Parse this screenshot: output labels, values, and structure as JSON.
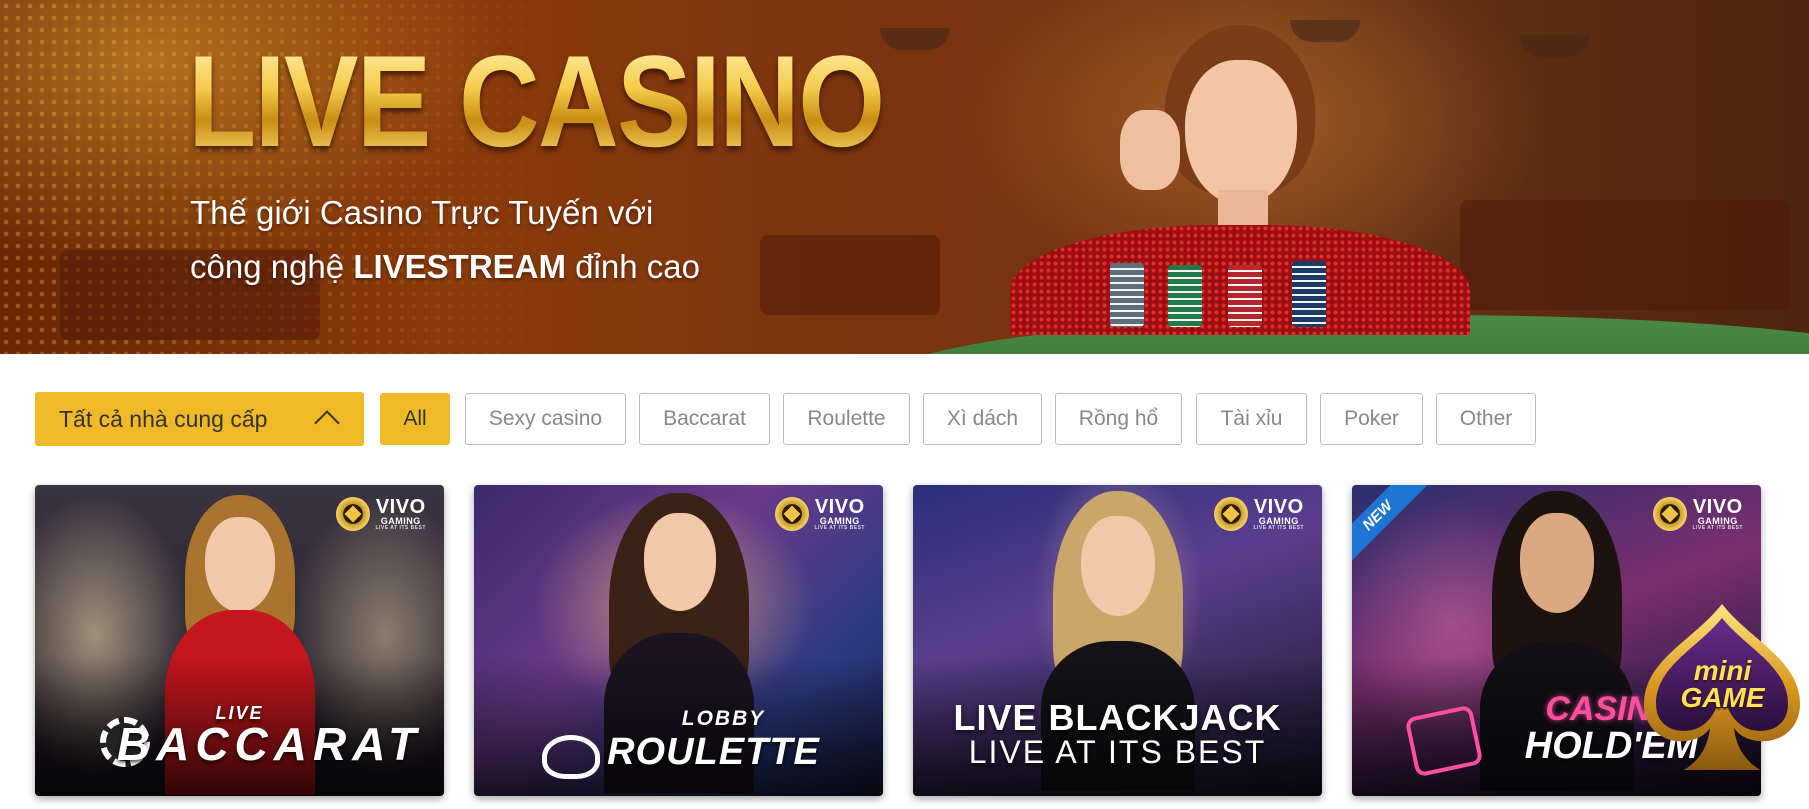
{
  "hero": {
    "title": "LIVE CASINO",
    "subtitle_line1": "Thế giới Casino Trực Tuyến với",
    "subtitle_line2_prefix": "công nghệ",
    "subtitle_line2_bold": "LIVESTREAM",
    "subtitle_line2_suffix": "đỉnh cao"
  },
  "filters": {
    "provider_select": "Tất cả nhà cung cấp",
    "tabs": [
      "All",
      "Sexy casino",
      "Baccarat",
      "Roulette",
      "Xì dách",
      "Rồng hổ",
      "Tài xỉu",
      "Poker",
      "Other"
    ],
    "active_tab": "All"
  },
  "games": [
    {
      "title_small": "LIVE",
      "title": "BACCARAT",
      "brand": "VIVO",
      "brand_sub": "GAMING",
      "brand_tag": "LIVE AT ITS BEST"
    },
    {
      "title_small": "LOBBY",
      "title": "ROULETTE",
      "brand": "VIVO",
      "brand_sub": "GAMING",
      "brand_tag": "LIVE AT ITS BEST"
    },
    {
      "title_line1": "LIVE BLACKJACK",
      "title_line2": "LIVE AT ITS BEST",
      "brand": "VIVO",
      "brand_sub": "GAMING",
      "brand_tag": "LIVE AT ITS BEST"
    },
    {
      "ribbon": "NEW",
      "title_line1": "CASINO",
      "title_line2": "HOLD'EM",
      "brand": "VIVO",
      "brand_sub": "GAMING",
      "brand_tag": "LIVE AT ITS BEST"
    }
  ],
  "mini_game": {
    "line1": "mini",
    "line2": "GAME"
  },
  "colors": {
    "accent": "#f0b928",
    "tab_border": "#bcbcbc",
    "tab_text": "#888888"
  }
}
